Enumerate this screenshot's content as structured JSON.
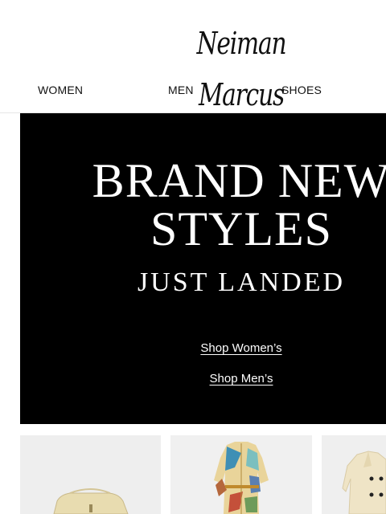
{
  "header": {
    "logo": "Neiman Marcus"
  },
  "nav": {
    "items": [
      "WOMEN",
      "MEN",
      "SHOES"
    ]
  },
  "hero": {
    "line1": "BRAND NEW",
    "line2": "STYLES",
    "line3": "JUST LANDED",
    "link_women": "Shop Women’s",
    "link_men": "Shop Men’s",
    "background": "#000000",
    "text_color": "#ffffff"
  },
  "products": [
    {
      "name": "handbag"
    },
    {
      "name": "printed-shirt-dress"
    },
    {
      "name": "cream-coat"
    }
  ]
}
